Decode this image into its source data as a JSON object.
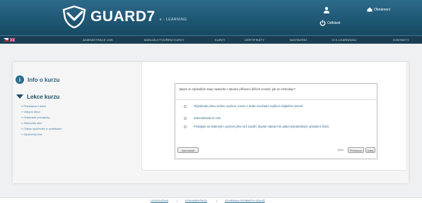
{
  "header": {
    "brand": "GUARD7",
    "brand_sub": "e - LEARNING",
    "logout_label": "Odhlásit",
    "contact_label": "Obnámení"
  },
  "nav": {
    "items": [
      "ADMINISTRACE LMS",
      "MANUÁLY/TVOŘENÍ KURZY",
      "KURZY",
      "CERTIFIKÁTY",
      "NASTAVENÍ",
      "O E-LEARNINGU",
      "KONTAKTY"
    ]
  },
  "sidebar": {
    "info_title": "Info o kurzu",
    "lessons_title": "Lekce kurzu",
    "items": [
      "» Představení lekce",
      "» Vstupní lekce",
      "» Odebrané poznámky",
      "» Sledování akcí",
      "» Odkaz vyučování a vzdělávání",
      "» Závěrečný test"
    ]
  },
  "quiz": {
    "question": "Jakým ze způsobům stanj nastavíte v tabulce přiřazení dílčích ceností, jak se rozhoduje?",
    "options": [
      "Objednejte plnou ordinu vyučení, konce v drahu současní zvýšení nějakého úrovně.",
      "Zamestnávat se role.",
      "Probíjejte se kratinným vyučení přes než zaváží, abyste nabraní ke ptátel jednatelským výslušení činků."
    ],
    "buttons": {
      "submit": "Vyhodnotit",
      "previous": "Předchozí",
      "next": "Další"
    },
    "page_indicator": "5/10"
  },
  "footer": {
    "links": [
      "LEGISLATIVA",
      "DOKUMENTACE",
      "OCHRANA OSOBNÍCH ÚDAJŮ"
    ]
  },
  "colors": {
    "header": "#1e5672",
    "nav": "#1a3f52",
    "accent": "#2a6d8f"
  }
}
